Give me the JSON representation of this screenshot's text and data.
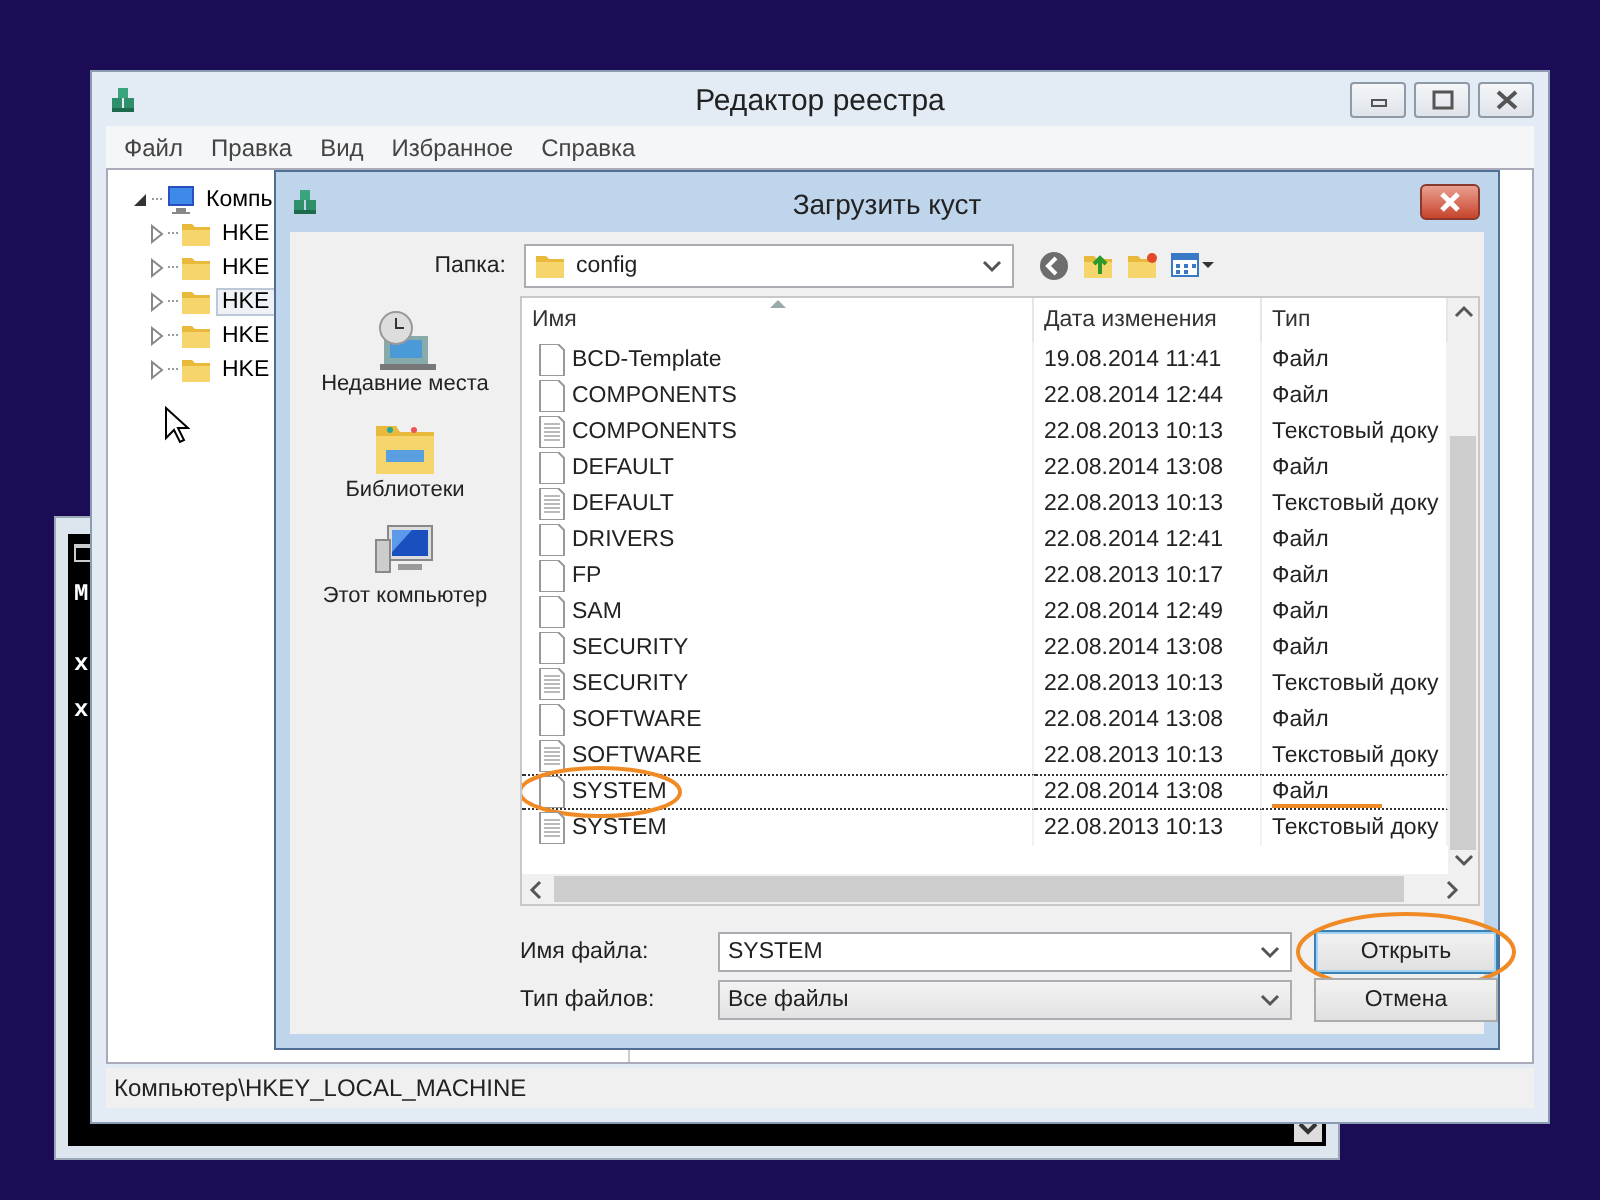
{
  "console_window": {
    "lines": [
      "M",
      "x",
      "x"
    ]
  },
  "regedit": {
    "title": "Редактор реестра",
    "menu": [
      "Файл",
      "Правка",
      "Вид",
      "Избранное",
      "Справка"
    ],
    "tree": {
      "label": "Компь",
      "expanded": true,
      "children": [
        {
          "label": "HKE",
          "expanded": false,
          "selected": false
        },
        {
          "label": "HKE",
          "expanded": false,
          "selected": false
        },
        {
          "label": "HKE",
          "expanded": false,
          "selected": true
        },
        {
          "label": "HKE",
          "expanded": false,
          "selected": false
        },
        {
          "label": "HKE",
          "expanded": false,
          "selected": false
        }
      ]
    },
    "status_bar": "Компьютер\\HKEY_LOCAL_MACHINE"
  },
  "dialog": {
    "title": "Загрузить куст",
    "folder_label": "Папка:",
    "folder": "config",
    "places": [
      {
        "label": "Недавние места",
        "kind": "recent"
      },
      {
        "label": "Библиотеки",
        "kind": "libraries"
      },
      {
        "label": "Этот компьютер",
        "kind": "computer"
      }
    ],
    "columns": [
      "Имя",
      "Дата изменения",
      "Тип"
    ],
    "files": [
      {
        "name": "BCD-Template",
        "date": "19.08.2014 11:41",
        "type": "Файл",
        "kind": "file",
        "focused": false,
        "circled": false,
        "type_underlined": false
      },
      {
        "name": "COMPONENTS",
        "date": "22.08.2014 12:44",
        "type": "Файл",
        "kind": "file",
        "focused": false,
        "circled": false,
        "type_underlined": false
      },
      {
        "name": "COMPONENTS",
        "date": "22.08.2013 10:13",
        "type": "Текстовый доку",
        "kind": "text",
        "focused": false,
        "circled": false,
        "type_underlined": false
      },
      {
        "name": "DEFAULT",
        "date": "22.08.2014 13:08",
        "type": "Файл",
        "kind": "file",
        "focused": false,
        "circled": false,
        "type_underlined": false
      },
      {
        "name": "DEFAULT",
        "date": "22.08.2013 10:13",
        "type": "Текстовый доку",
        "kind": "text",
        "focused": false,
        "circled": false,
        "type_underlined": false
      },
      {
        "name": "DRIVERS",
        "date": "22.08.2014 12:41",
        "type": "Файл",
        "kind": "file",
        "focused": false,
        "circled": false,
        "type_underlined": false
      },
      {
        "name": "FP",
        "date": "22.08.2013 10:17",
        "type": "Файл",
        "kind": "file",
        "focused": false,
        "circled": false,
        "type_underlined": false
      },
      {
        "name": "SAM",
        "date": "22.08.2014 12:49",
        "type": "Файл",
        "kind": "file",
        "focused": false,
        "circled": false,
        "type_underlined": false
      },
      {
        "name": "SECURITY",
        "date": "22.08.2014 13:08",
        "type": "Файл",
        "kind": "file",
        "focused": false,
        "circled": false,
        "type_underlined": false
      },
      {
        "name": "SECURITY",
        "date": "22.08.2013 10:13",
        "type": "Текстовый доку",
        "kind": "text",
        "focused": false,
        "circled": false,
        "type_underlined": false
      },
      {
        "name": "SOFTWARE",
        "date": "22.08.2014 13:08",
        "type": "Файл",
        "kind": "file",
        "focused": false,
        "circled": false,
        "type_underlined": false
      },
      {
        "name": "SOFTWARE",
        "date": "22.08.2013 10:13",
        "type": "Текстовый доку",
        "kind": "text",
        "focused": false,
        "circled": false,
        "type_underlined": false
      },
      {
        "name": "SYSTEM",
        "date": "22.08.2014 13:08",
        "type": "Файл",
        "kind": "file",
        "focused": true,
        "circled": true,
        "type_underlined": true
      },
      {
        "name": "SYSTEM",
        "date": "22.08.2013 10:13",
        "type": "Текстовый доку",
        "kind": "text",
        "focused": false,
        "circled": false,
        "type_underlined": false
      }
    ],
    "file_name_label": "Имя файла:",
    "file_name": "SYSTEM",
    "file_type_label": "Тип файлов:",
    "file_type": "Все файлы",
    "buttons": [
      {
        "label": "Открыть",
        "default": true,
        "circled": true
      },
      {
        "label": "Отмена",
        "default": false,
        "circled": false
      }
    ]
  }
}
